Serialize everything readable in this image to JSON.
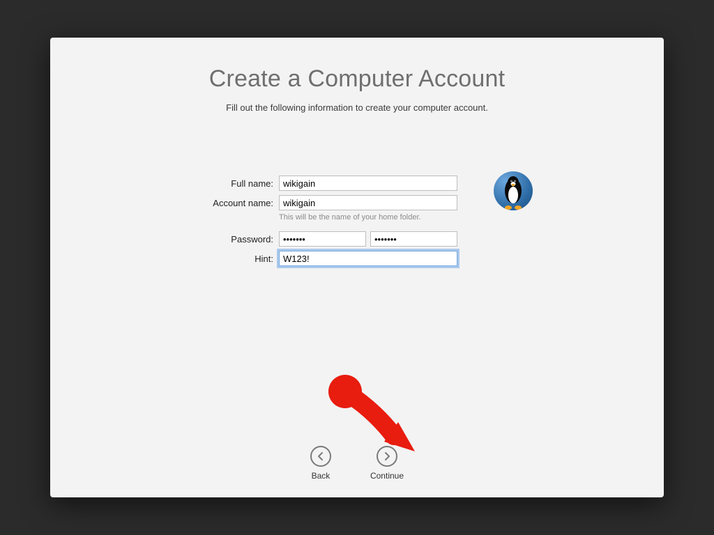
{
  "title": "Create a Computer Account",
  "subtitle": "Fill out the following information to create your computer account.",
  "form": {
    "full_name": {
      "label": "Full name:",
      "value": "wikigain"
    },
    "account_name": {
      "label": "Account name:",
      "value": "wikigain",
      "helper": "This will be the name of your home folder."
    },
    "password": {
      "label": "Password:",
      "value": "•••••••",
      "verify": "•••••••"
    },
    "hint": {
      "label": "Hint:",
      "value": "W123!"
    }
  },
  "avatar": {
    "name": "penguin-avatar"
  },
  "nav": {
    "back": {
      "label": "Back"
    },
    "continue": {
      "label": "Continue"
    }
  }
}
